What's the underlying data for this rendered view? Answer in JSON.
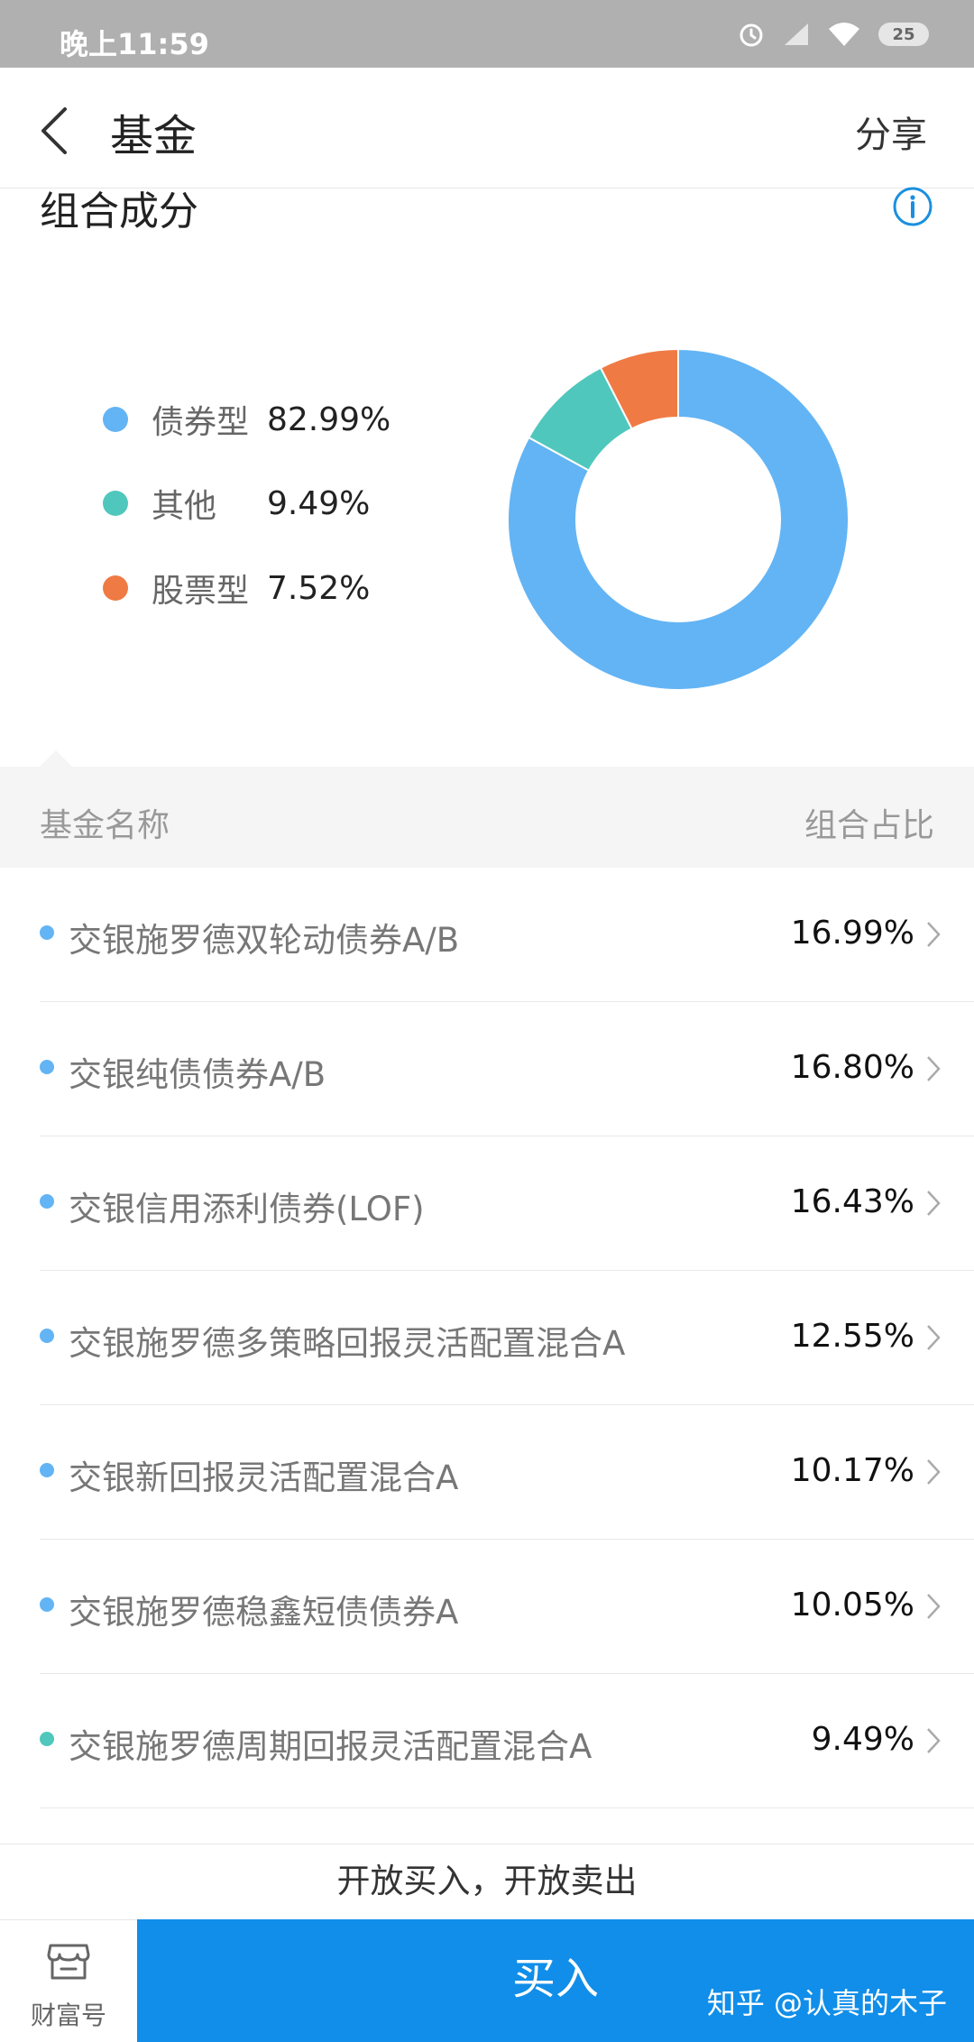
{
  "status_bar": {
    "time": "晚上11:59",
    "battery": "25"
  },
  "header": {
    "title": "基金",
    "share_label": "分享"
  },
  "composition": {
    "title": "组合成分",
    "legend": [
      {
        "label": "债券型",
        "value": "82.99%",
        "color": "#63b4f4"
      },
      {
        "label": "其他",
        "value": "9.49%",
        "color": "#4fc7bd"
      },
      {
        "label": "股票型",
        "value": "7.52%",
        "color": "#f07a44"
      }
    ]
  },
  "chart_data": {
    "type": "pie",
    "categories": [
      "债券型",
      "其他",
      "股票型"
    ],
    "values": [
      82.99,
      9.49,
      7.52
    ],
    "colors": [
      "#63b4f4",
      "#4fc7bd",
      "#f07a44"
    ],
    "donut": true
  },
  "table": {
    "col_name": "基金名称",
    "col_ratio": "组合占比",
    "rows": [
      {
        "name": "交银施罗德双轮动债券A/B",
        "pct": "16.99%",
        "color": "#63b4f4"
      },
      {
        "name": "交银纯债债券A/B",
        "pct": "16.80%",
        "color": "#63b4f4"
      },
      {
        "name": "交银信用添利债券(LOF)",
        "pct": "16.43%",
        "color": "#63b4f4"
      },
      {
        "name": "交银施罗德多策略回报灵活配置混合A",
        "pct": "12.55%",
        "color": "#63b4f4"
      },
      {
        "name": "交银新回报灵活配置混合A",
        "pct": "10.17%",
        "color": "#63b4f4"
      },
      {
        "name": "交银施罗德稳鑫短债债券A",
        "pct": "10.05%",
        "color": "#63b4f4"
      },
      {
        "name": "交银施罗德周期回报灵活配置混合A",
        "pct": "9.49%",
        "color": "#4fc7bd"
      }
    ]
  },
  "footer": {
    "open_status": "开放买入，开放卖出",
    "wealth_label": "财富号",
    "buy_label": "买入",
    "watermark": "知乎 @认真的木子"
  },
  "colors": {
    "accent": "#108ee9"
  }
}
